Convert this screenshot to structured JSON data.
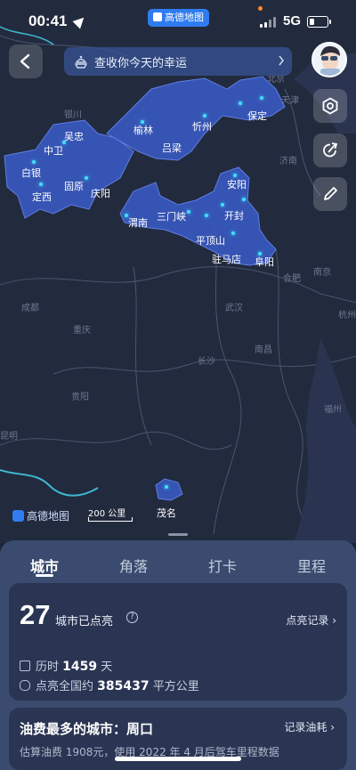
{
  "status_bar": {
    "time": "00:41",
    "network": "5G",
    "badge": "高德地图"
  },
  "header": {
    "fortune_text": "查收你今天的幸运"
  },
  "map": {
    "lit_color": "#3a5cc8",
    "region_labels": {
      "yinchuan": "银川",
      "wuzhong": "吴忠",
      "zhongwei": "中卫",
      "baiyin": "白银",
      "guyuan": "固原",
      "dingxi": "定西",
      "qingyang": "庆阳",
      "yulin": "榆林",
      "lvliang": "吕梁",
      "xinzhou": "忻州",
      "baoding": "保定",
      "beijing": "北京",
      "tianjin": "天津",
      "jinan": "济南",
      "anyang": "安阳",
      "kaifeng": "开封",
      "sanmenxia": "三门峡",
      "weinan": "渭南",
      "pingdingshan": "平顶山",
      "zhumadian": "驻马店",
      "fuyang": "阜阳",
      "hefei": "合肥",
      "nanjing": "南京",
      "hangzhou": "杭州",
      "chengdu": "成都",
      "chongqing": "重庆",
      "wuhan": "武汉",
      "changsha": "长沙",
      "nanchang": "南昌",
      "guiyang": "贵阳",
      "fuzhou": "福州",
      "kunming": "昆明",
      "maoming": "茂名"
    },
    "logo_text": "高德地图",
    "scale_text": "200 公里"
  },
  "tabs": [
    "城市",
    "角落",
    "打卡",
    "里程"
  ],
  "summary": {
    "count": "27",
    "count_label": "城市已点亮",
    "help_symbol": "?",
    "light_records": "点亮记录",
    "duration_label": "历时",
    "duration_value": "1459",
    "duration_unit": "天",
    "area_label": "点亮全国约",
    "area_value": "385437",
    "area_unit": "平方公里"
  },
  "fuel": {
    "title": "油费最多的城市：周口",
    "record_label": "记录油耗",
    "subtitle": "估算油费 1908元，使用 2022 年 4 月后驾车里程数据"
  }
}
